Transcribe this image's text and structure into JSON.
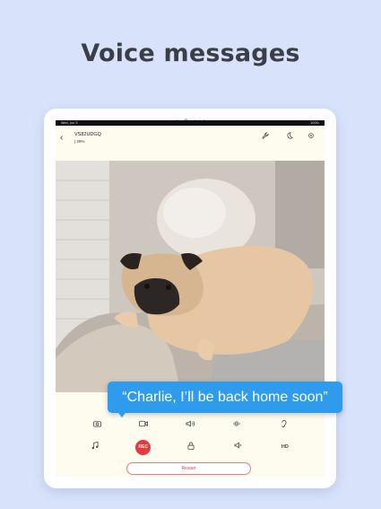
{
  "headline": "Voice messages",
  "statusbar": {
    "left": "Wed, Jun 5",
    "right": "100%"
  },
  "appbar": {
    "device_name": "VS82UDGQ",
    "device_sub": "| 29%",
    "back_icon": "chevron-left-icon",
    "icons": [
      "wrench-icon",
      "moon-icon",
      "gear-icon"
    ]
  },
  "controls": {
    "row1": [
      "camera-icon",
      "video-icon",
      "volume-icon",
      "audio-wave-icon",
      "hearing-icon"
    ],
    "row2": [
      "music-icon",
      "record-button",
      "lock-icon",
      "speaker-icon",
      "hd-icon"
    ],
    "record_label": "REC",
    "hd_label": "HD",
    "restart_label": "Restart"
  },
  "voice_message": "“Charlie, I’ll be back home soon”",
  "colors": {
    "background": "#d8e3fb",
    "bubble": "#2f9bec",
    "accent": "#e8373d"
  }
}
